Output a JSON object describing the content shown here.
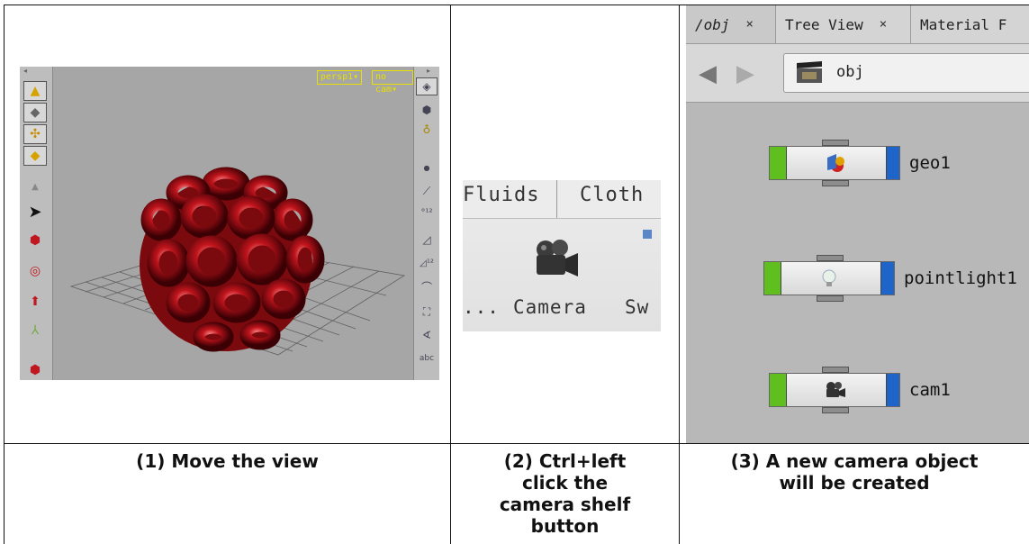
{
  "panel1": {
    "viewport_menus": [
      "persp1",
      "no cam"
    ],
    "left_toolbar_icons": [
      "point-light-icon",
      "spotlight-icon",
      "transform-icon",
      "handle-icon",
      "select-arrow-icon",
      "move-view-icon",
      "tumble-icon",
      "translate-icon",
      "axes-icon",
      "pose-icon"
    ],
    "right_toolbar_icons": [
      "display-options-icon",
      "camera-icon",
      "light-icon",
      "point-display-icon",
      "normals-icon",
      "point-numbers-icon",
      "prim-normals-icon",
      "prim-numbers-icon",
      "curve-icon",
      "frame-icon",
      "measure-icon",
      "abc-label-icon"
    ],
    "caption": "(1) Move the view"
  },
  "panel2": {
    "tabs": [
      "Fluids",
      "Cloth"
    ],
    "tools": [
      "...",
      "Camera",
      "Sw"
    ],
    "caption": [
      "(2) Ctrl+left",
      "click the",
      "camera shelf",
      "button"
    ]
  },
  "panel3": {
    "tabs": [
      {
        "label": "/obj"
      },
      {
        "label": "Tree View"
      },
      {
        "label": "Material F"
      }
    ],
    "close_glyph": "×",
    "path": "obj",
    "nodes": [
      {
        "name": "geo1",
        "icon": "geometry-icon"
      },
      {
        "name": "pointlight1",
        "icon": "light-bulb-icon"
      },
      {
        "name": "cam1",
        "icon": "camera-icon"
      }
    ],
    "caption": [
      "(3) A new camera object",
      "will be created"
    ]
  },
  "colors": {
    "viewport_menu": "#e7e000",
    "node_green": "#5fbf1f",
    "node_blue": "#1f64c9",
    "torus_red": "#c0141c"
  }
}
